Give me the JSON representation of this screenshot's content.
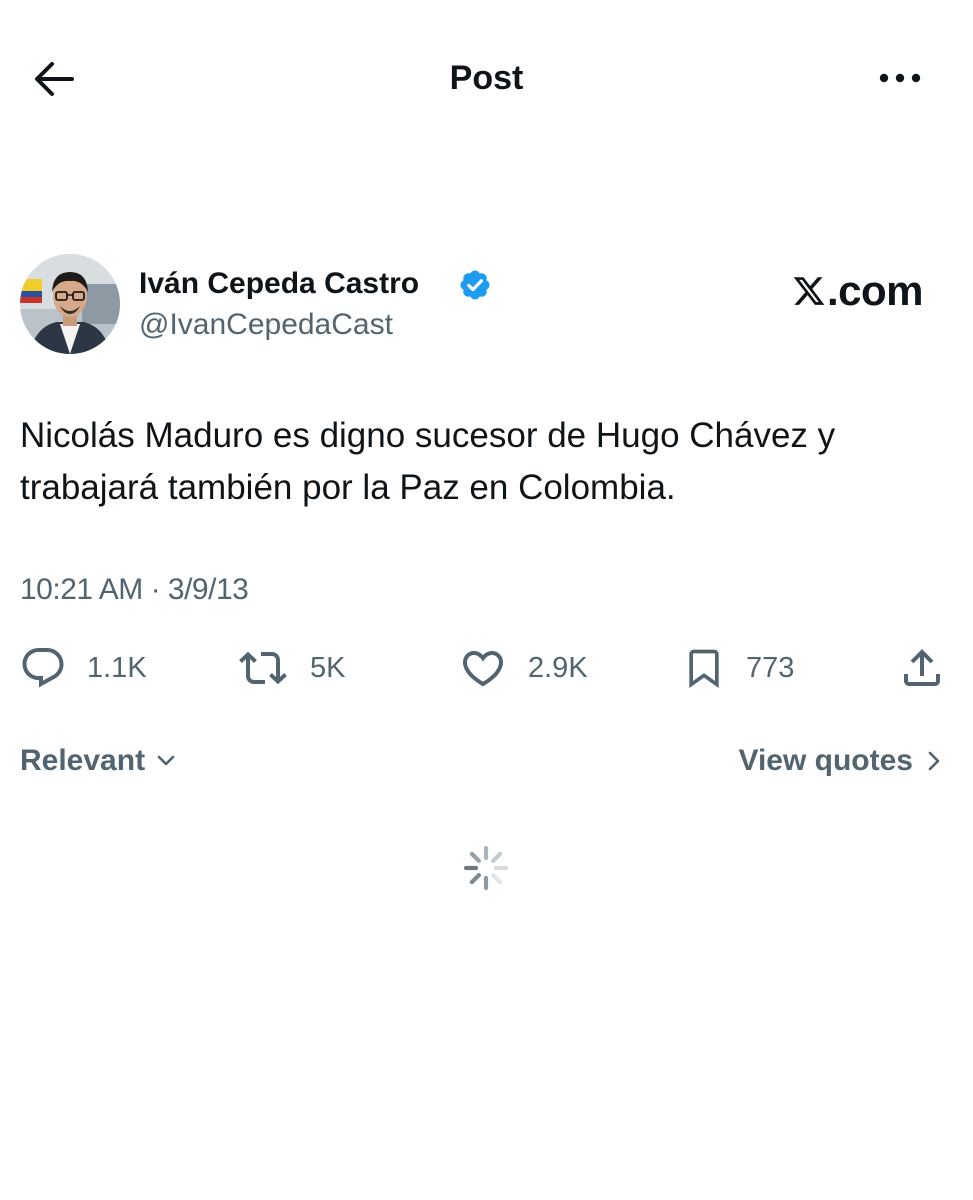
{
  "header": {
    "title": "Post",
    "back_icon": "arrow-left-icon",
    "more_icon": "ellipsis-icon"
  },
  "author": {
    "name": "Iván Cepeda Castro",
    "handle": "@IvanCepedaCast",
    "verified": true,
    "badge_icon": "verified-badge-icon"
  },
  "watermark": {
    "text": ".com",
    "logo_icon": "x-logo-icon"
  },
  "tweet": {
    "text": "Nicolás Maduro es digno sucesor de Hugo Chávez y trabajará también por la Paz en Colombia.",
    "timestamp": "10:21 AM · 3/9/13"
  },
  "actions": {
    "replies": "1.1K",
    "reposts": "5K",
    "likes": "2.9K",
    "bookmarks": "773",
    "reply_icon": "reply-icon",
    "repost_icon": "repost-icon",
    "like_icon": "heart-icon",
    "bookmark_icon": "bookmark-icon",
    "share_icon": "share-icon"
  },
  "replies_bar": {
    "sort_label": "Relevant",
    "view_quotes_label": "View quotes"
  },
  "colors": {
    "text_primary": "#0f1419",
    "text_secondary": "#536471",
    "verified_blue": "#1d9bf0",
    "background": "#ffffff"
  }
}
